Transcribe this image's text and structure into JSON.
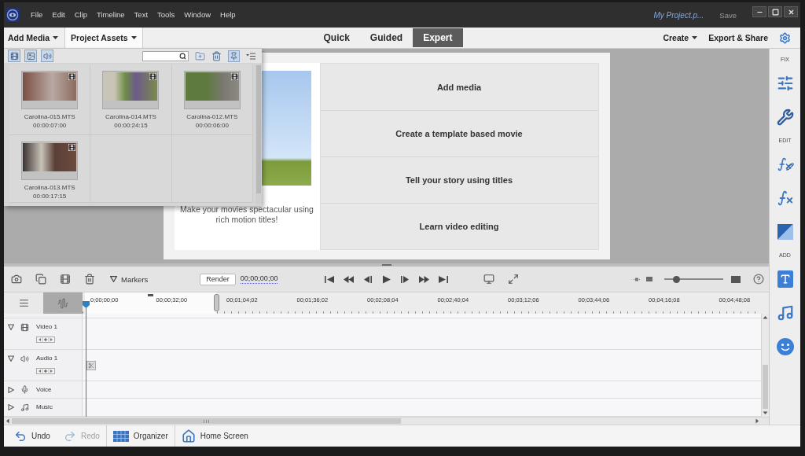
{
  "window": {
    "title": "My Project.p...",
    "save": "Save"
  },
  "menu": [
    {
      "label": "File"
    },
    {
      "label": "Edit"
    },
    {
      "label": "Clip"
    },
    {
      "label": "Timeline"
    },
    {
      "label": "Text"
    },
    {
      "label": "Tools"
    },
    {
      "label": "Window"
    },
    {
      "label": "Help"
    }
  ],
  "toolbar": {
    "panels": [
      {
        "label": "Add Media",
        "selected": false
      },
      {
        "label": "Project Assets",
        "selected": true
      }
    ],
    "modes": [
      {
        "label": "Quick",
        "selected": false
      },
      {
        "label": "Guided",
        "selected": false
      },
      {
        "label": "Expert",
        "selected": true
      }
    ],
    "actions": [
      {
        "label": "Create",
        "dropdown": true
      },
      {
        "label": "Export & Share",
        "dropdown": false
      }
    ]
  },
  "asset_panel": {
    "pinned": true,
    "assets": [
      {
        "name": "Carolina-015.MTS",
        "duration": "00:00:07:00"
      },
      {
        "name": "Carolina-014.MTS",
        "duration": "00:00:24:15"
      },
      {
        "name": "Carolina-012.MTS",
        "duration": "00:00:06:00"
      },
      {
        "name": "Carolina-013.MTS",
        "duration": "00:00:17:15"
      }
    ]
  },
  "welcome": {
    "caption": "Make your movies spectacular using rich motion titles!",
    "options": [
      {
        "label": "Add media"
      },
      {
        "label": "Create a template based movie"
      },
      {
        "label": "Tell your story using titles"
      },
      {
        "label": "Learn video editing"
      }
    ]
  },
  "timeline_toolbar": {
    "markers": "Markers",
    "render": "Render",
    "timecode": "00;00;00;00",
    "zoom": {
      "level": 0.2
    }
  },
  "ruler": {
    "waveform": {
      "on": true
    },
    "ticks": [
      "0;00;00;00",
      "00;00;32;00",
      "00;01;04;02",
      "00;01;36;02",
      "00;02;08;04",
      "00;02;40;04",
      "00;03;12;06",
      "00;03;44;06",
      "00;04;16;08",
      "00;04;48;08"
    ]
  },
  "tracks": [
    {
      "name": "Video 1",
      "kind": "video",
      "expanded": true,
      "marker": false
    },
    {
      "name": "Audio 1",
      "kind": "audio",
      "expanded": true,
      "marker": true
    },
    {
      "name": "Voice",
      "kind": "voice",
      "expanded": false,
      "marker": false
    },
    {
      "name": "Music",
      "kind": "music",
      "expanded": false,
      "marker": false
    }
  ],
  "sidebar": {
    "sections": [
      {
        "label": "FIX",
        "kind": "fix"
      },
      {
        "label": "EDIT",
        "kind": "edit"
      },
      {
        "label": "ADD",
        "kind": "add"
      }
    ]
  },
  "bottom_bar": {
    "items": [
      {
        "label": "Undo",
        "kind": "undo",
        "disabled": false
      },
      {
        "label": "Redo",
        "kind": "redo",
        "disabled": true
      },
      {
        "label": "Organizer",
        "kind": "organizer",
        "disabled": false
      },
      {
        "label": "Home Screen",
        "kind": "home",
        "disabled": false
      }
    ]
  }
}
